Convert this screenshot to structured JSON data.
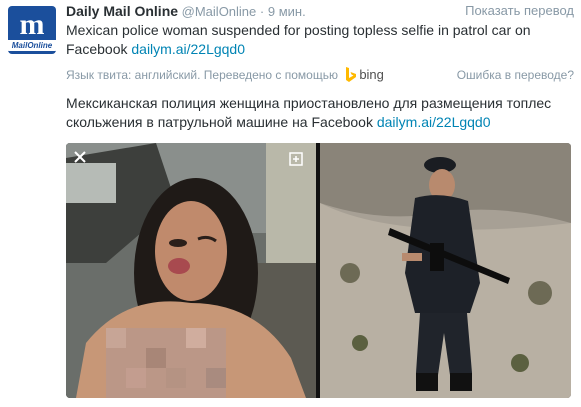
{
  "tweet": {
    "avatar": {
      "glyph": "m",
      "brand": "MailOnline"
    },
    "fullname": "Daily Mail Online",
    "screen_name": "@MailOnline",
    "separator": "·",
    "time": "9 мин.",
    "show_translation": "Показать перевод",
    "text": "Mexican police woman suspended for posting topless selfie in patrol car on Facebook",
    "link": "dailym.ai/22Lgqd0",
    "translation_meta": {
      "label": "Язык твита: английский. Переведено с помощью",
      "provider": "bing",
      "wrong_translation": "Ошибка в переводе?"
    },
    "translated_text": "Мексиканская полиция женщина приостановлено для размещения топлес скольжения в патрульной машине на Facebook",
    "translated_link": "dailym.ai/22Lgqd0"
  },
  "colors": {
    "text": "#292f33",
    "muted": "#8899a6",
    "link": "#0084b4",
    "avatar_bg": "#1b4f9c",
    "bing": "#ffb900"
  },
  "icons": {
    "close": "close-icon",
    "expand": "expand-icon",
    "bing": "bing-logo-icon"
  }
}
